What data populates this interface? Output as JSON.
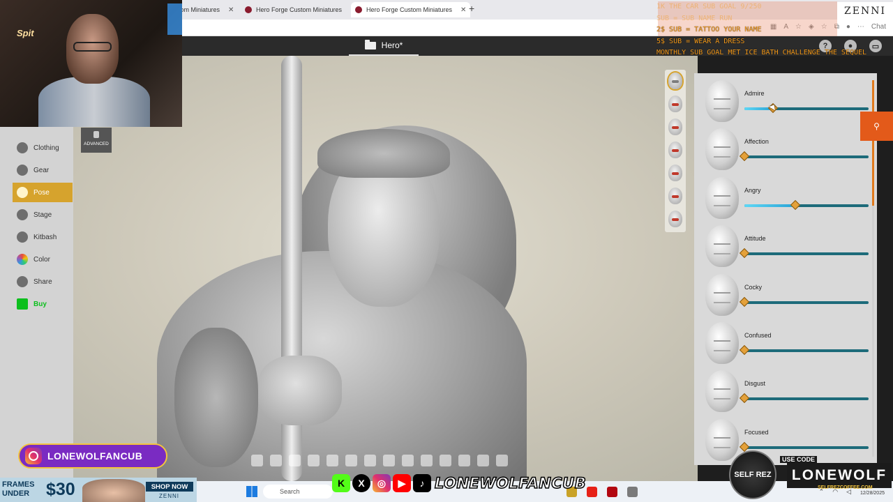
{
  "browser": {
    "tabs": [
      {
        "title": "tom Miniatures",
        "active": false
      },
      {
        "title": "Hero Forge Custom Miniatures",
        "active": false
      },
      {
        "title": "Hero Forge Custom Miniatures",
        "active": true
      }
    ],
    "new_tab": "+",
    "toolbar_icons": [
      "grid-icon",
      "font-icon",
      "star-icon",
      "extension-icon",
      "favorites-icon",
      "collections-icon",
      "profile-icon",
      "more-icon",
      "chat-icon"
    ],
    "chat_label": "Chat"
  },
  "app": {
    "title": "Hero*",
    "header_icons": {
      "help": "?",
      "account": "account-icon",
      "cart": "cart-icon"
    }
  },
  "left_menu": {
    "items": [
      {
        "label": "Clothing",
        "icon": "shirt-icon",
        "active": false
      },
      {
        "label": "Gear",
        "icon": "swords-icon",
        "active": false
      },
      {
        "label": "Pose",
        "icon": "pose-icon",
        "active": true
      },
      {
        "label": "Stage",
        "icon": "stage-icon",
        "active": false
      },
      {
        "label": "Kitbash",
        "icon": "kitbash-icon",
        "active": false
      },
      {
        "label": "Color",
        "icon": "palette-icon",
        "active": false
      },
      {
        "label": "Share",
        "icon": "share-icon",
        "active": false
      },
      {
        "label": "Buy",
        "icon": "cart-icon",
        "active": false
      }
    ],
    "advanced_label": "ADVANCED"
  },
  "emotions": [
    {
      "label": "Admire",
      "value": 0.23
    },
    {
      "label": "Affection",
      "value": 0.0
    },
    {
      "label": "Angry",
      "value": 0.41
    },
    {
      "label": "Attitude",
      "value": 0.0
    },
    {
      "label": "Cocky",
      "value": 0.0
    },
    {
      "label": "Confused",
      "value": 0.0
    },
    {
      "label": "Disgust",
      "value": 0.0
    },
    {
      "label": "Focused",
      "value": 0.0
    }
  ],
  "side_tab_icon": "pose-tab-icon",
  "stream": {
    "goals": [
      {
        "text": "1K THE CAR SUB GOAL 9/250",
        "style": "faint"
      },
      {
        "text": " SUB = SUB NAME RUN",
        "style": "faint"
      },
      {
        "text": "2$ SUB = TATTOO YOUR NAME",
        "style": "bright"
      },
      {
        "text": "5$ SUB = WEAR A DRESS",
        "style": "bright"
      },
      {
        "text": "MONTHLY SUB GOAL MET ICE BATH CHALLENGE THE SEQUEL",
        "style": "bright"
      }
    ],
    "corner_brand": "ZENNI",
    "handle": "LONEWOLFANCUB",
    "social_handle": "LONEWOLFANCUB",
    "webcam_sign": "Spit",
    "frames": {
      "line1": "FRAMES",
      "line2": "UNDER",
      "price": "$30",
      "cta": "SHOP NOW",
      "brand": "ZENNI"
    },
    "sponsor": {
      "code_label": "USE CODE",
      "code": "LONEWOLF",
      "url": "SELFREZCOFFEE.COM",
      "emblem": "SELF REZ"
    }
  },
  "taskbar": {
    "search_placeholder": "Search",
    "date": "12/28/2025"
  }
}
